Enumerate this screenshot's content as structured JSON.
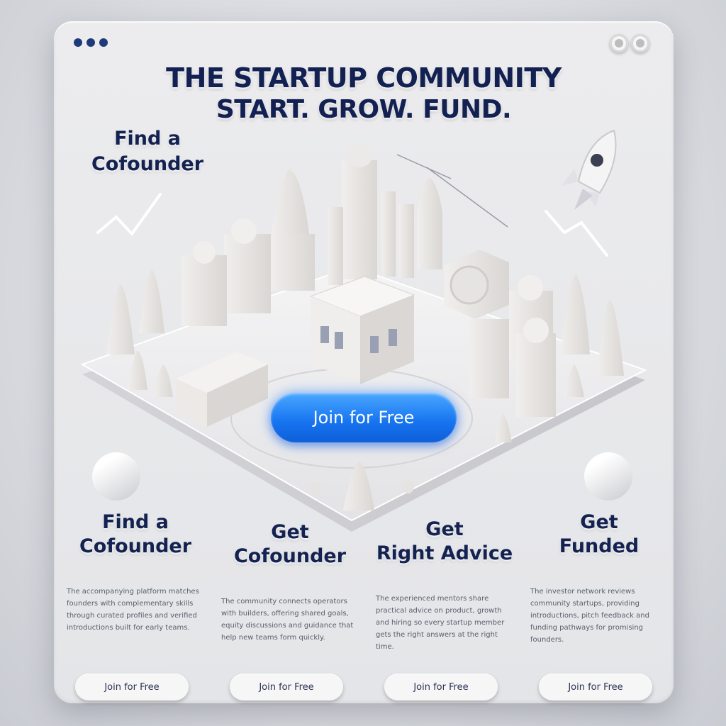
{
  "header": {
    "headline_line1": "THE STARTUP COMMUNITY",
    "headline_line2": "START. GROW. FUND."
  },
  "side_heading": "Find a\nCofounder",
  "cta": {
    "label": "Join for Free"
  },
  "features": [
    {
      "title": "Find a\nCofounder",
      "body": "The accompanying platform matches founders with complementary skills through curated profiles and verified introductions built for early teams.",
      "button": "Join for Free"
    },
    {
      "title": "Get\nCofounder",
      "body": "The community connects operators with builders, offering shared goals, equity discussions and guidance that help new teams form quickly.",
      "button": "Join for Free"
    },
    {
      "title": "Get\nRight Advice",
      "body": "The experienced mentors share practical advice on product, growth and hiring so every startup member gets the right answers at the right time.",
      "button": "Join for Free"
    },
    {
      "title": "Get\nFunded",
      "body": "The investor network reviews community startups, providing introductions, pitch feedback and funding pathways for promising founders.",
      "button": "Join for Free"
    }
  ],
  "colors": {
    "headline": "#122152",
    "cta_blue": "#1673f0",
    "window_bg": "#ececee"
  },
  "icons": [
    "rocket-icon",
    "window-control-icon"
  ]
}
